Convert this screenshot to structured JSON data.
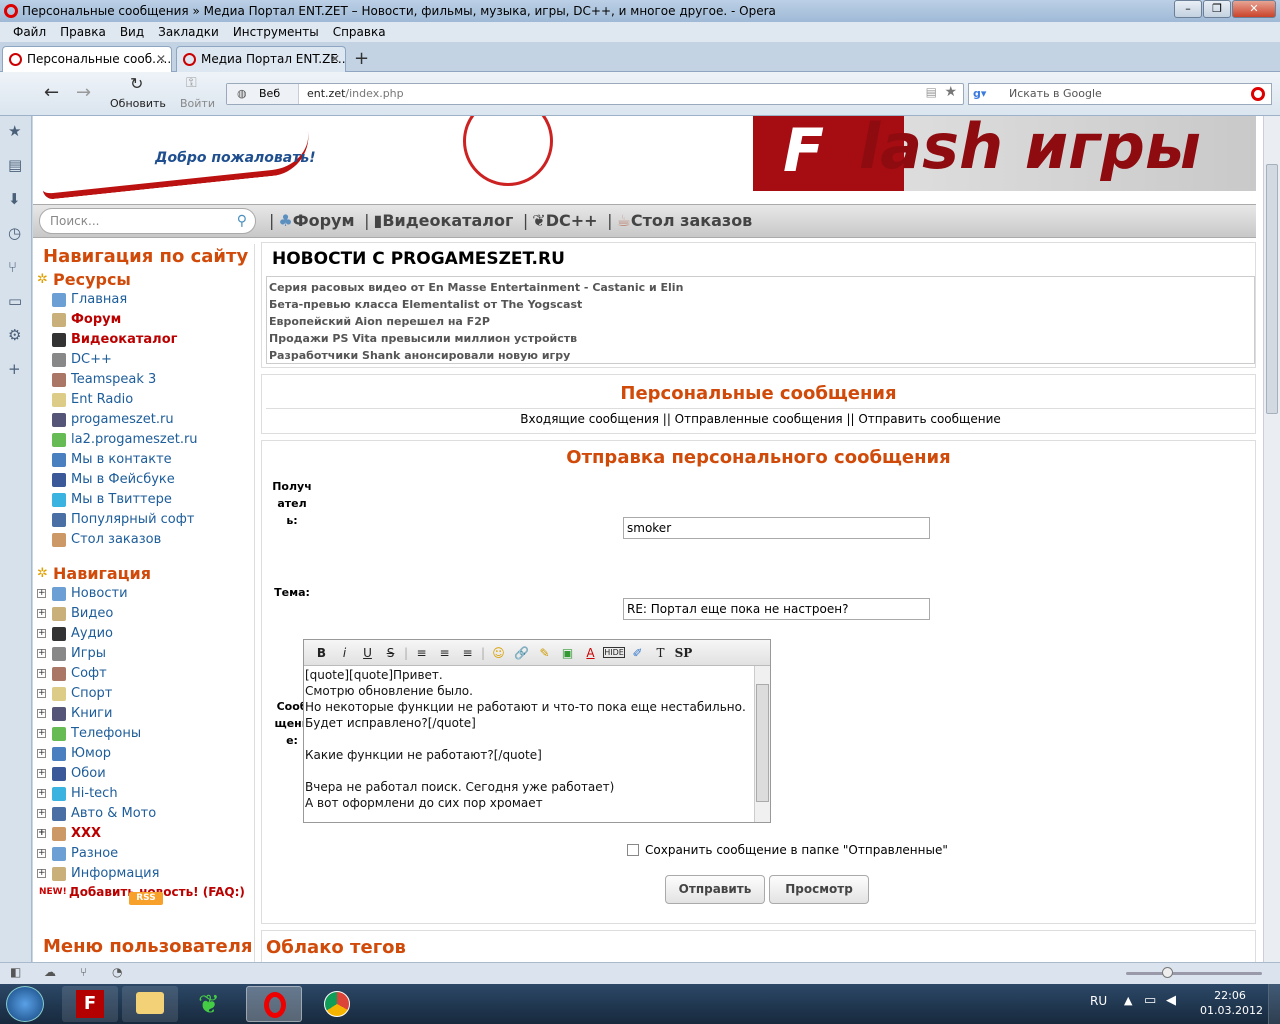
{
  "window": {
    "title": "Персональные сообщения » Медиа Портал ENT.ZET – Новости, фильмы, музыка, игры, DC++, и многое другое. - Opera"
  },
  "menubar": [
    "Файл",
    "Правка",
    "Вид",
    "Закладки",
    "Инструменты",
    "Справка"
  ],
  "tabs": [
    {
      "label": "Персональные сооб......",
      "active": true
    },
    {
      "label": "Медиа Портал ENT.ZE...",
      "active": false
    }
  ],
  "toolbar": {
    "reload_label": "Обновить",
    "login_label": "Войти",
    "web_label": "Веб",
    "url_host": "ent.zet",
    "url_path": "/index.php",
    "search_placeholder": "Искать в Google"
  },
  "page": {
    "welcome": "Добро пожаловать!",
    "banner_first": "F",
    "banner_rest": "lash игры",
    "search_placeholder": "Поиск...",
    "topnav": [
      "Форум",
      "Видеокаталог",
      "DC++",
      "Стол заказов"
    ],
    "sidebar_title": "Навигация по сайту",
    "resources_title": "Ресурсы",
    "resources": [
      {
        "label": "Главная",
        "red": false
      },
      {
        "label": "Форум",
        "red": true
      },
      {
        "label": "Видеокаталог",
        "red": true
      },
      {
        "label": "DC++",
        "red": false
      },
      {
        "label": "Teamspeak 3",
        "red": false
      },
      {
        "label": "Ent Radio",
        "red": false
      },
      {
        "label": "progameszet.ru",
        "red": false
      },
      {
        "label": "la2.progameszet.ru",
        "red": false
      },
      {
        "label": "Мы в контакте",
        "red": false
      },
      {
        "label": "Мы в Фейсбуке",
        "red": false
      },
      {
        "label": "Мы в Твиттере",
        "red": false
      },
      {
        "label": "Популярный софт",
        "red": false
      },
      {
        "label": "Стол заказов",
        "red": false
      }
    ],
    "nav_title": "Навигация",
    "nav_items": [
      {
        "label": "Новости",
        "red": false
      },
      {
        "label": "Видео",
        "red": false
      },
      {
        "label": "Аудио",
        "red": false
      },
      {
        "label": "Игры",
        "red": false
      },
      {
        "label": "Софт",
        "red": false
      },
      {
        "label": "Спорт",
        "red": false
      },
      {
        "label": "Книги",
        "red": false
      },
      {
        "label": "Телефоны",
        "red": false
      },
      {
        "label": "Юмор",
        "red": false
      },
      {
        "label": "Обои",
        "red": false
      },
      {
        "label": "Hi-tech",
        "red": false
      },
      {
        "label": "Авто & Мото",
        "red": false
      },
      {
        "label": "XXX",
        "red": true
      },
      {
        "label": "Разное",
        "red": false
      },
      {
        "label": "Информация",
        "red": false
      }
    ],
    "add_news": "Добавить новость! (FAQ:)",
    "rss": "RSS",
    "user_menu_title": "Меню пользователя",
    "news_title": "НОВОСТИ С PROGAMESZET.RU",
    "news": [
      "Серия расовых видео от En Masse Entertainment - Castanic и Elin",
      "Бета-превью класса Elementalist от The Yogscast",
      "Европейский Aion перешел на F2P",
      "Продажи PS Vita превысили миллион устройств",
      "Разработчики Shank анонсировали новую игру"
    ],
    "pm_title": "Персональные сообщения",
    "pm_links": "Входящие сообщения || Отправленные сообщения || Отправить сообщение",
    "send_title": "Отправка персонального сообщения",
    "recipient_label": "Получатель:",
    "recipient_value": "smoker",
    "subject_label": "Тема:",
    "subject_value": "RE: Портал еще пока не настроен?",
    "message_label": "Сообщение:",
    "editor_buttons": [
      "B",
      "i",
      "U",
      "S",
      "≡",
      "≡",
      "≡",
      "☺",
      "🔗",
      "✎",
      "▣",
      "A",
      "HIDE",
      "✐",
      "T",
      "SP"
    ],
    "message_lines": [
      "[quote][quote]Привет.",
      "Смотрю обновление было.",
      "Но некоторые функции не работают и что-то пока еще нестабильно.",
      "Будет исправлено?[/quote]",
      "",
      "Какие функции не работают?[/quote]",
      "",
      "Вчера не работал поиск. Сегодня уже работает)",
      "А вот оформлени до сих пор хромает"
    ],
    "save_copy_label": "Сохранить сообщение в папке \"Отправленные\"",
    "send_button": "Отправить",
    "preview_button": "Просмотр",
    "tags_title": "Облако тегов"
  },
  "taskbar": {
    "lang": "RU",
    "time": "22:06",
    "date": "01.03.2012"
  }
}
